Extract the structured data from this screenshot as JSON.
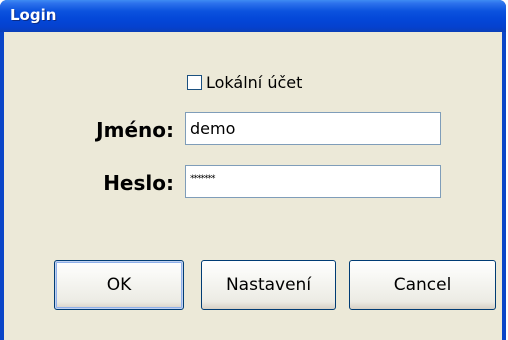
{
  "window": {
    "title": "Login"
  },
  "local_account": {
    "label": "Lokální účet",
    "checked": false
  },
  "fields": {
    "name": {
      "label": "Jméno:",
      "value": "demo"
    },
    "password": {
      "label": "Heslo:",
      "value": "*******"
    }
  },
  "buttons": {
    "ok": "OK",
    "settings": "Nastavení",
    "cancel": "Cancel"
  }
}
